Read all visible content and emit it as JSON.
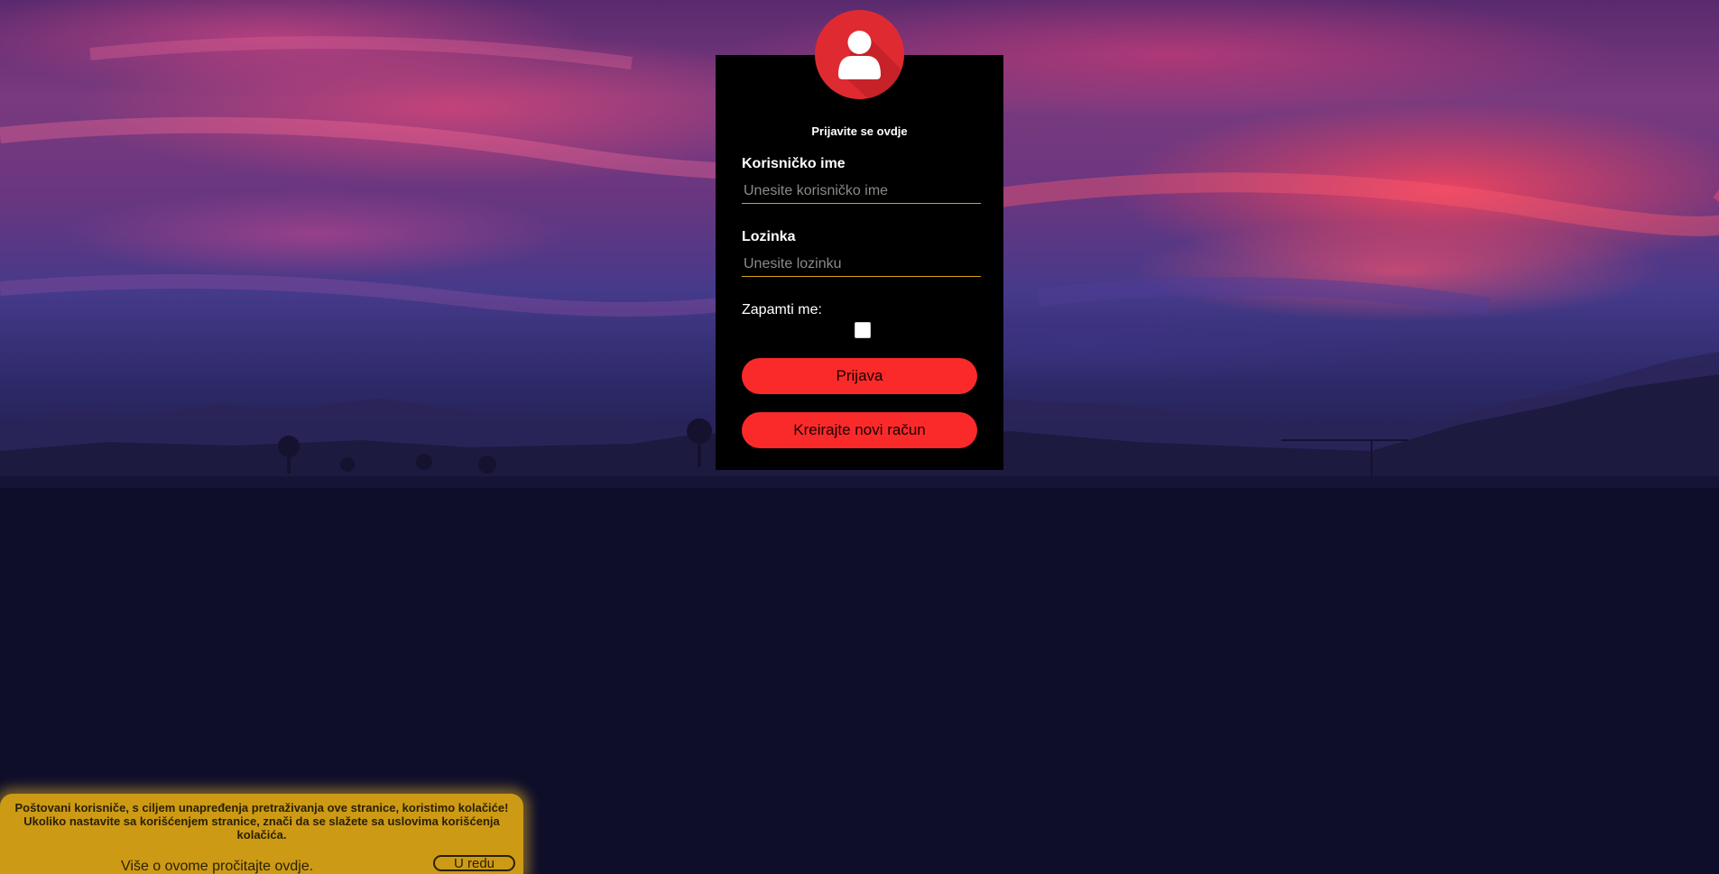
{
  "login": {
    "title": "Prijavite se ovdje",
    "username_label": "Korisničko ime",
    "username_placeholder": "Unesite korisničko ime",
    "password_label": "Lozinka",
    "password_placeholder": "Unesite lozinku",
    "remember_label": "Zapamti me:",
    "remember_checked": false,
    "submit_label": "Prijava",
    "register_label": "Kreirajte novi račun"
  },
  "cookie_banner": {
    "message": "Poštovani korisniče, s ciljem unapređenja pretraživanja ove stranice, koristimo kolačiće! Ukoliko nastavite sa korišćenjem stranice, znači da se slažete sa uslovima korišćenja kolačića.",
    "more_link": "Više o ovome pročitajte ovdje.",
    "ok_label": "U redu"
  },
  "icons": {
    "avatar": "user-icon"
  },
  "colors": {
    "accent_red": "#fb2a2a",
    "avatar_red": "#e02a31",
    "input_underline": "#d4a21c",
    "cookie_bg": "#cc9a14",
    "card_bg": "#000000",
    "page_bg": "#0e0e2a"
  }
}
